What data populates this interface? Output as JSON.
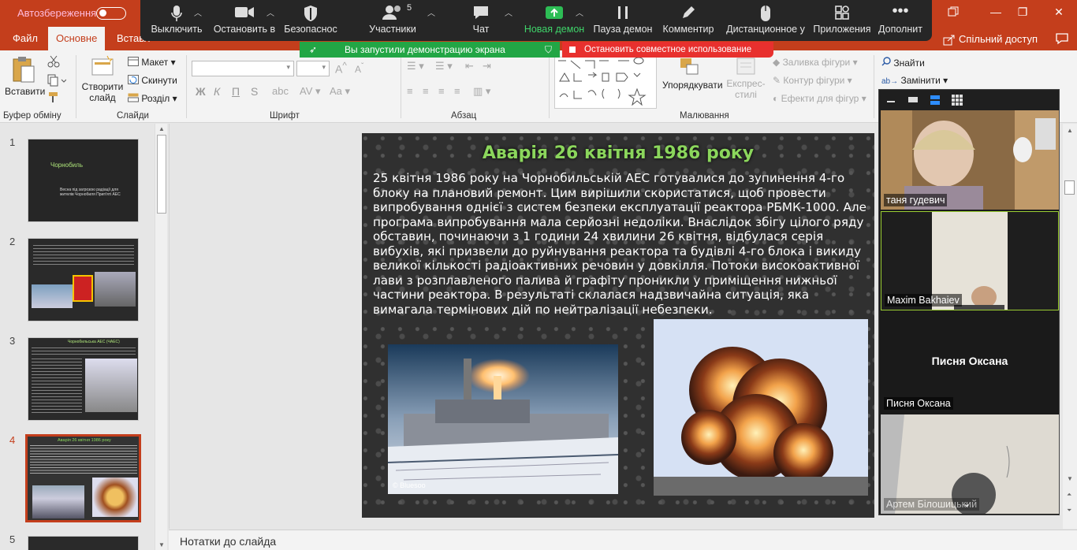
{
  "titlebar": {
    "autosave_label": "Автозбереження",
    "autosave_state": "off"
  },
  "window_controls": {
    "restore_icon": "restore-window-icon",
    "minimize": "—",
    "maximize": "❐",
    "close": "✕"
  },
  "zoom_toolbar": {
    "mute_label": "Выключить",
    "video_label": "Остановить в",
    "security_label": "Безопаснос",
    "participants_label": "Участники",
    "participants_count": "5",
    "chat_label": "Чат",
    "new_share_label": "Новая демон",
    "pause_share_label": "Пауза демон",
    "annotate_label": "Комментир",
    "remote_label": "Дистанционное у",
    "apps_label": "Приложения",
    "more_label": "Дополнит"
  },
  "sharing_banner": {
    "text": "Вы запустили демонстрацию экрана",
    "stop_text": "Остановить совместное использование"
  },
  "ribbon_tabs": {
    "file": "Файл",
    "home": "Основне",
    "insert": "Вставл",
    "share": "Спільний доступ"
  },
  "ribbon": {
    "clipboard": {
      "paste": "Вставити",
      "group": "Буфер обміну"
    },
    "slides": {
      "new_slide": "Створити",
      "new_slide_2": "слайд",
      "layout": "Макет",
      "reset": "Скинути",
      "section": "Розділ",
      "group": "Слайди"
    },
    "font": {
      "group": "Шрифт",
      "bold": "Ж",
      "italic": "К",
      "underline": "П",
      "strike": "S"
    },
    "paragraph": {
      "group": "Абзац"
    },
    "drawing": {
      "arrange": "Упорядкувати",
      "quick_styles": "Експрес-",
      "quick_styles_2": "стилі",
      "shape_fill": "Заливка фігури",
      "shape_outline": "Контур фігури",
      "shape_effects": "Ефекти для фігур",
      "group": "Малювання"
    },
    "editing": {
      "find": "Знайти",
      "replace": "Замінити"
    }
  },
  "thumbnails": [
    {
      "number": "1",
      "title": "Чорнобиль",
      "body": "Весна під загрозою радіації для жителів Чорнобиля Прип'яті АЕС"
    },
    {
      "number": "2",
      "title": "",
      "body": ""
    },
    {
      "number": "3",
      "title": "Чорнобильська АЕС (ЧАЕС)",
      "body": ""
    },
    {
      "number": "4",
      "title": "Аварія 26 квітня 1986 року",
      "body": ""
    },
    {
      "number": "5",
      "title": "",
      "body": ""
    }
  ],
  "selected_slide": "4",
  "slide": {
    "title": "Аварія 26 квітня 1986 року",
    "body": "25 квітня 1986 року на Чорнобильській АЕС готувалися до зупинення  4-го блоку на плановий  ремонт. Цим вирішили скористатися, щоб провести випробування однієї з систем безпеки експлуатації реактора РБМК-1000. Але програма випробування мала серйозні недоліки. Внаслідок збігу цілого ряду обставин, починаючи з 1 години 24 хвилини 26 квітня, відбулася серія вибухів, які призвели до руйнування реактора та будівлі 4-го блока і викиду великої кількості радіоактивних речовин у довкілля. Потоки високоактивної лави з розплавленого палива й графіту проникли у приміщення нижньої частини реактора. В результаті склалася надзвичайна ситуація, яка вимагала термінових дій по нейтралізації небезпеки.",
    "photo1_watermark": "© Bluesoo"
  },
  "notes_label": "Нотатки до слайда",
  "gallery": {
    "participants": [
      {
        "name": "таня гудевич",
        "type": "video"
      },
      {
        "name": "Maxim Bakhaiev",
        "type": "video",
        "active": true
      },
      {
        "name": "Писня Оксана",
        "type": "name-only",
        "center_name": "Писня Оксана"
      },
      {
        "name": "Артем Білошицький",
        "type": "video"
      }
    ]
  }
}
